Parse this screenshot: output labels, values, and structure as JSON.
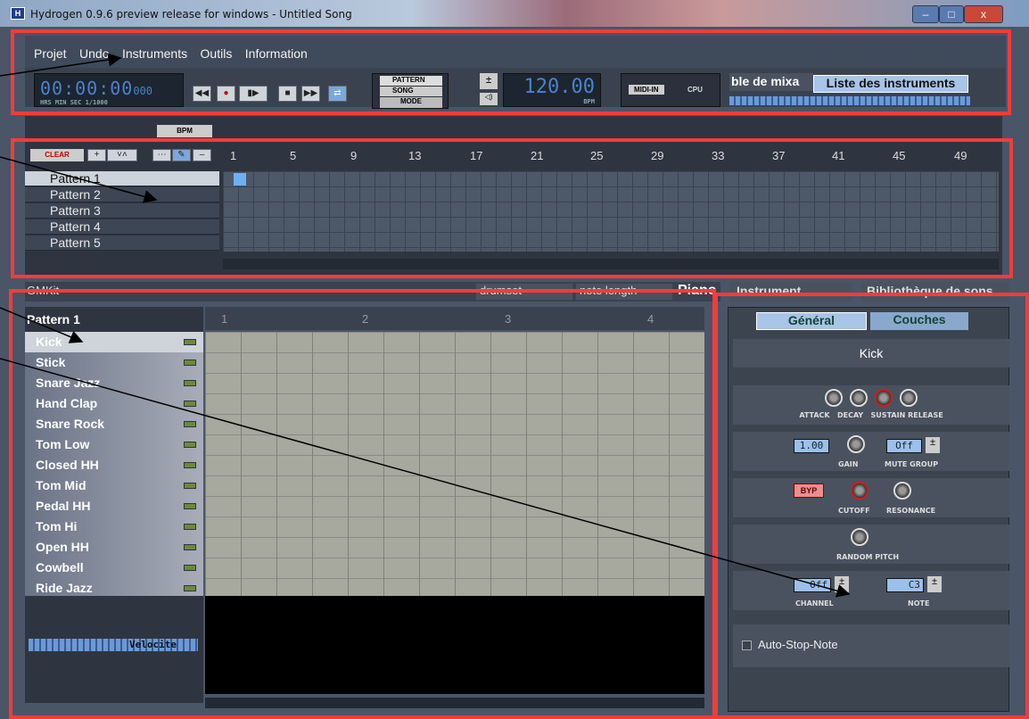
{
  "window": {
    "title": "Hydrogen 0.9.6 preview release for windows - Untitled Song",
    "minimize": "–",
    "maximize": "□",
    "close": "x"
  },
  "menu": [
    "Projet",
    "Undo",
    "Instruments",
    "Outils",
    "Information"
  ],
  "transport": {
    "time": "00:00:00",
    "ms": "000",
    "time_labels": "HRS   MIN   SEC  1/1000",
    "bpm": "120.00",
    "bpm_label": "BPM",
    "mode_pattern": "PATTERN",
    "mode_song": "SONG",
    "mode_label": "MODE",
    "midi": "MIDI-IN",
    "cpu": "CPU",
    "mixer_tab": "ble de mixa",
    "instruments_tab": "Liste des instruments"
  },
  "song": {
    "bpm_btn": "BPM",
    "clear": "CLEAR",
    "ruler": [
      "1",
      "5",
      "9",
      "13",
      "17",
      "21",
      "25",
      "29",
      "33",
      "37",
      "41",
      "45",
      "49"
    ],
    "patterns": [
      "Pattern 1",
      "Pattern 2",
      "Pattern 3",
      "Pattern 4",
      "Pattern 5"
    ],
    "active_cell": {
      "pattern": 1,
      "bar": 1
    }
  },
  "editor": {
    "kit": "GMKit",
    "pattern": "Pattern 1",
    "drumset": "drumset",
    "note_length": "note length",
    "piano": "Piano",
    "beats": [
      "1",
      "2",
      "3",
      "4"
    ],
    "velocity": "Velocite",
    "instruments": [
      "Kick",
      "Stick",
      "Snare Jazz",
      "Hand Clap",
      "Snare Rock",
      "Tom Low",
      "Closed HH",
      "Tom Mid",
      "Pedal HH",
      "Tom Hi",
      "Open HH",
      "Cowbell",
      "Ride Jazz"
    ]
  },
  "instrument_panel": {
    "tab1": "Instrument",
    "tab2": "Bibliothèque de sons",
    "general": "Général",
    "layers": "Couches",
    "name": "Kick",
    "adsr": [
      "ATTACK",
      "DECAY",
      "SUSTAIN",
      "RELEASE"
    ],
    "gain_value": "1.00",
    "gain": "GAIN",
    "mute_value": "Off",
    "mute": "MUTE GROUP",
    "byp": "BYP",
    "cutoff": "CUTOFF",
    "resonance": "RESONANCE",
    "random_pitch": "RANDOM PITCH",
    "channel_value": "Off",
    "channel": "CHANNEL",
    "note_value": "C3",
    "note": "NOTE",
    "autostop": "Auto-Stop-Note"
  },
  "colors": {
    "annotation": "#f23c3c",
    "accent": "#4d82c9"
  }
}
